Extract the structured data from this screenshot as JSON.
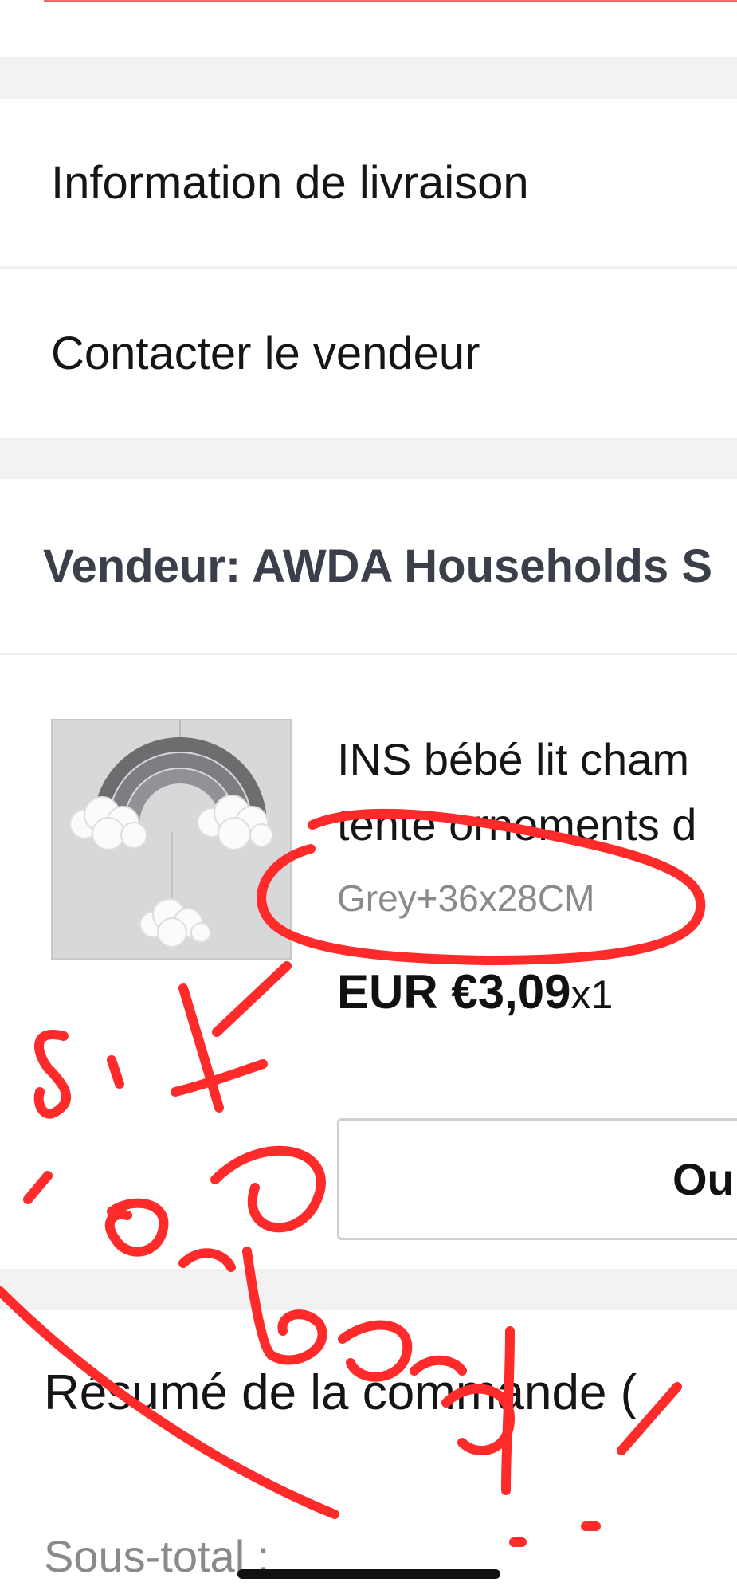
{
  "menu": {
    "delivery_info": "Information de livraison",
    "contact_seller": "Contacter le vendeur"
  },
  "seller": {
    "label": "Vendeur: AWDA Households S"
  },
  "product": {
    "thumbnail": "rainbow-clouds-mobile-image",
    "title_line1": "INS bébé lit cham",
    "title_line2": "tente ornements d",
    "variant": "Grey+36x28CM",
    "price": "EUR €3,09",
    "quantity": "x1",
    "action_label": "Ou"
  },
  "summary": {
    "title": "Résumé de la commande (",
    "subtotal_label": "Sous-total :"
  },
  "annotation": {
    "handwritten_text": "Si the ordered!",
    "color": "#ff2a2a"
  },
  "colors": {
    "accent_line": "#f06a6a",
    "section_gap": "#f2f2f2",
    "seller_text": "#3b3f4a",
    "muted_text": "#8a8a8a"
  }
}
